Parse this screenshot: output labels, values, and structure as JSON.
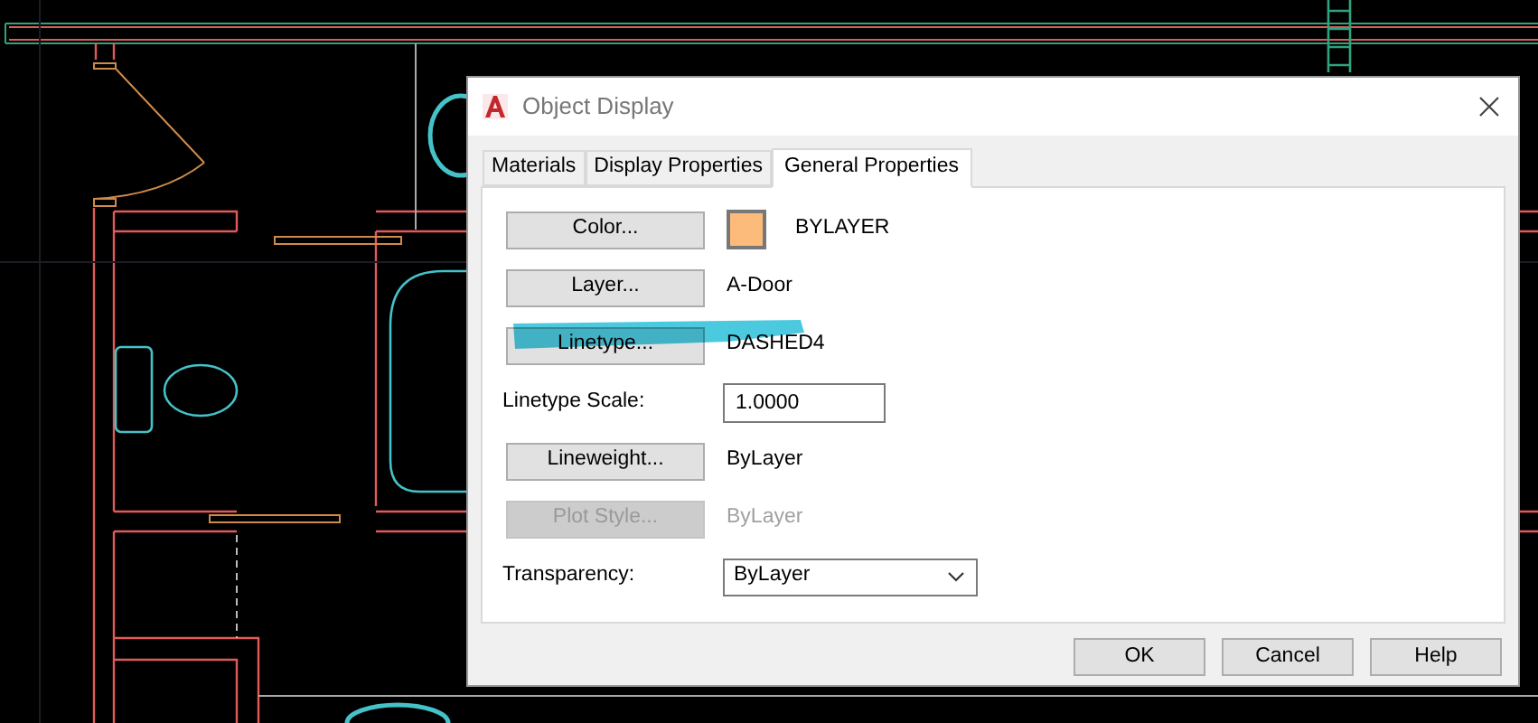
{
  "window": {
    "title": "Object Display"
  },
  "tabs": [
    {
      "label": "Materials",
      "selected": false
    },
    {
      "label": "Display Properties",
      "selected": false
    },
    {
      "label": "General Properties",
      "selected": true
    }
  ],
  "rows": [
    {
      "kind": "button",
      "label": "Color...",
      "disabled": false,
      "color": "#fdbb7b",
      "value": "BYLAYER"
    },
    {
      "kind": "button",
      "label": "Layer...",
      "disabled": false,
      "value": "A-Door"
    },
    {
      "kind": "button",
      "label": "Linetype...",
      "disabled": false,
      "value": "DASHED4"
    },
    {
      "kind": "input",
      "label": "Linetype Scale:",
      "value": "1.0000"
    },
    {
      "kind": "button",
      "label": "Lineweight...",
      "disabled": false,
      "value": "ByLayer"
    },
    {
      "kind": "button",
      "label": "Plot Style...",
      "disabled": true,
      "value": "ByLayer"
    },
    {
      "kind": "dropdown",
      "label": "Transparency:",
      "value": "ByLayer"
    }
  ],
  "buttons": [
    "OK",
    "Cancel",
    "Help"
  ]
}
